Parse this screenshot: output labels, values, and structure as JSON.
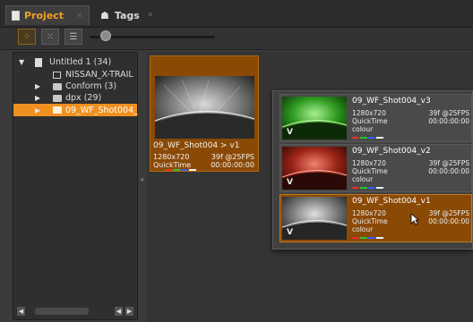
{
  "tabs": {
    "project_label": "Project",
    "tags_label": "Tags"
  },
  "toolbar": {
    "view_modes": [
      "grid-view-icon",
      "list-view-icon",
      "detail-view-icon"
    ],
    "zoom_level": 0.13
  },
  "sidebar": {
    "items": [
      {
        "label": "Untitled 1 (34)",
        "expanded": true
      },
      {
        "label": "NISSAN_X-TRAIL"
      },
      {
        "label": "Conform (3)"
      },
      {
        "label": "dpx (29)"
      },
      {
        "label": "09_WF_Shot004_",
        "selected": true
      }
    ]
  },
  "card": {
    "title": "09_WF_Shot004 > v1",
    "resolution": "1280x720",
    "frames_fps": "39f @25FPS",
    "format": "QuickTime",
    "timecode": "00:00:00:00"
  },
  "versions": [
    {
      "title": "09_WF_Shot004_v3",
      "resolution": "1280x720",
      "frames_fps": "39f @25FPS",
      "format": "QuickTime",
      "timecode": "00:00:00:00",
      "colour": "colour",
      "mark": "V",
      "tint": "green"
    },
    {
      "title": "09_WF_Shot004_v2",
      "resolution": "1280x720",
      "frames_fps": "39f @25FPS",
      "format": "QuickTime",
      "timecode": "00:00:00:00",
      "colour": "colour",
      "mark": "V",
      "tint": "red"
    },
    {
      "title": "09_WF_Shot004_v1",
      "resolution": "1280x720",
      "frames_fps": "39f @25FPS",
      "format": "QuickTime",
      "timecode": "00:00:00:00",
      "colour": "colour",
      "mark": "V",
      "tint": "grey",
      "selected": true
    }
  ],
  "colors": {
    "accent": "#f09020",
    "selected_bg": "#8a4a06",
    "panel_bg": "#343434"
  }
}
